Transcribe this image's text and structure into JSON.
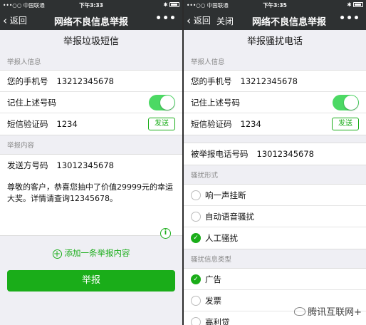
{
  "left": {
    "status": {
      "carrier": "•••○○ 中国联通 ",
      "time": "下午3:33",
      "right": "✱ "
    },
    "nav": {
      "back": "返回",
      "title": "网络不良信息举报",
      "more": "•••"
    },
    "page_title": "举报垃圾短信",
    "reporter_section": "举报人信息",
    "phone_label": "您的手机号",
    "phone_value": "13212345678",
    "remember_label": "记住上述号码",
    "sms_label": "短信验证码",
    "sms_value": "1234",
    "send_label": "发送",
    "content_section": "举报内容",
    "sender_label": "发送方号码",
    "sender_value": "13012345678",
    "message": "尊敬的客户，恭喜您抽中了价值29999元的幸运大奖。详情请查询12345678。",
    "add_label": "添加一条举报内容",
    "submit_label": "举报"
  },
  "right": {
    "status": {
      "carrier": "•••○○ 中国联通 ",
      "time": "下午3:35",
      "right": "✱ "
    },
    "nav": {
      "back": "返回",
      "close": "关闭",
      "title": "网络不良信息举报",
      "more": "•••"
    },
    "page_title": "举报骚扰电话",
    "reporter_section": "举报人信息",
    "phone_label": "您的手机号",
    "phone_value": "13212345678",
    "remember_label": "记住上述号码",
    "sms_label": "短信验证码",
    "sms_value": "1234",
    "send_label": "发送",
    "reported_label": "被举报电话号码",
    "reported_value": "13012345678",
    "harass_section": "骚扰形式",
    "harass_options": [
      "响一声挂断",
      "自动语音骚扰",
      "人工骚扰"
    ],
    "info_section": "骚扰信息类型",
    "info_options": [
      "广告",
      "发票",
      "高利贷"
    ],
    "watermark": "腾讯互联网+"
  }
}
